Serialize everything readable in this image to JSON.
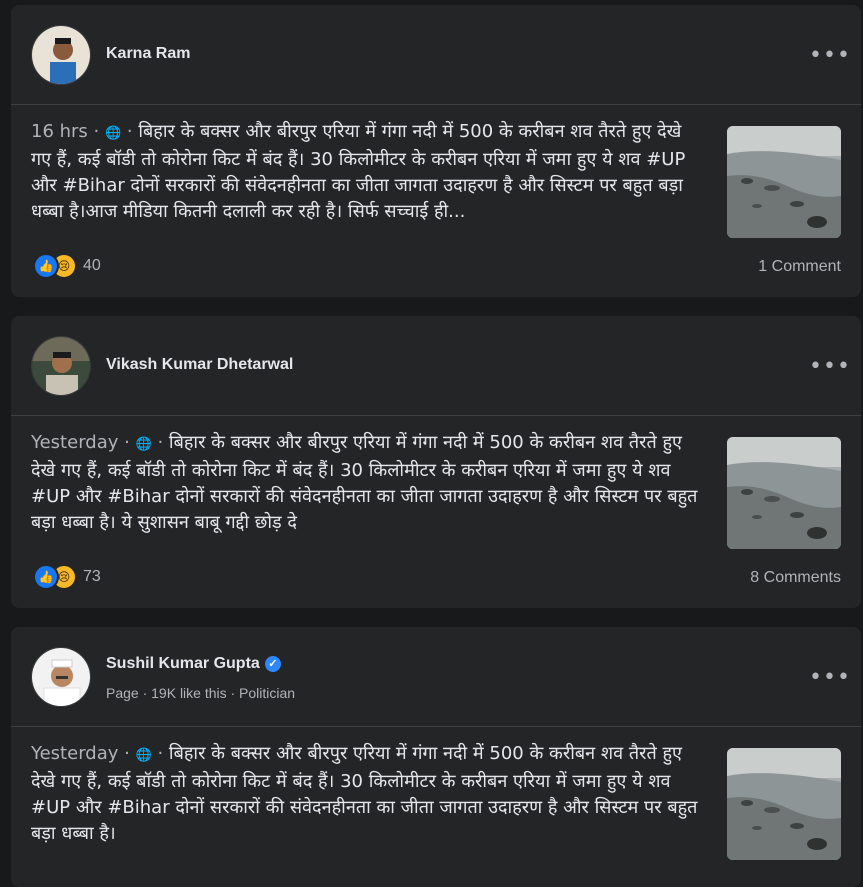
{
  "posts": [
    {
      "author": "Karna Ram",
      "verified": false,
      "meta": "",
      "time": "16 hrs",
      "text": "बिहार के बक्सर और बीरपुर एरिया में गंगा नदी में 500 के करीबन शव तैरते हुए देखे गए हैं, कई बॉडी तो कोरोना किट में बंद हैं। 30 किलोमीटर के करीबन एरिया में जमा हुए ये शव #UP और #Bihar दोनों सरकारों की संवेदनहीनता का जीता जागता उदाहरण है और सिस्टम पर बहुत बड़ा धब्बा है।आज मीडिया कितनी दलाली कर रही है। सिर्फ सच्चाई ही...",
      "reaction_count": "40",
      "comments": "1 Comment"
    },
    {
      "author": "Vikash Kumar Dhetarwal",
      "verified": false,
      "meta": "",
      "time": "Yesterday",
      "text": "बिहार के बक्सर और बीरपुर एरिया में गंगा नदी में 500 के करीबन शव तैरते हुए देखे गए हैं, कई बॉडी तो कोरोना किट में बंद हैं। 30 किलोमीटर के करीबन एरिया में जमा हुए ये शव #UP और #Bihar दोनों सरकारों की संवेदनहीनता का जीता जागता उदाहरण है और सिस्टम पर बहुत बड़ा धब्बा है। ये सुशासन बाबू गद्दी छोड़ दे",
      "reaction_count": "73",
      "comments": "8 Comments"
    },
    {
      "author": "Sushil Kumar Gupta",
      "verified": true,
      "meta": "Page · 19K like this · Politician",
      "time": "Yesterday",
      "text": "बिहार के बक्सर और बीरपुर एरिया में गंगा नदी में 500 के करीबन शव तैरते हुए देखे गए हैं, कई बॉडी तो कोरोना किट में बंद हैं। 30 किलोमीटर के करीबन एरिया में जमा हुए ये शव #UP और #Bihar दोनों सरकारों की संवेदनहीनता का जीता जागता उदाहरण है और सिस्टम पर बहुत बड़ा धब्बा है।",
      "reaction_count": "",
      "comments": ""
    }
  ],
  "ui": {
    "more_glyph": "•••",
    "globe_glyph": "🌐",
    "separator": " · ",
    "like_glyph": "👍",
    "sad_glyph": "😢",
    "verified_glyph": "✓"
  },
  "colors": {
    "background": "#18191a",
    "card": "#242526",
    "primary_text": "#e4e6eb",
    "secondary_text": "#b0b3b8",
    "like_blue": "#1877f2",
    "sad_yellow": "#f7b928"
  }
}
